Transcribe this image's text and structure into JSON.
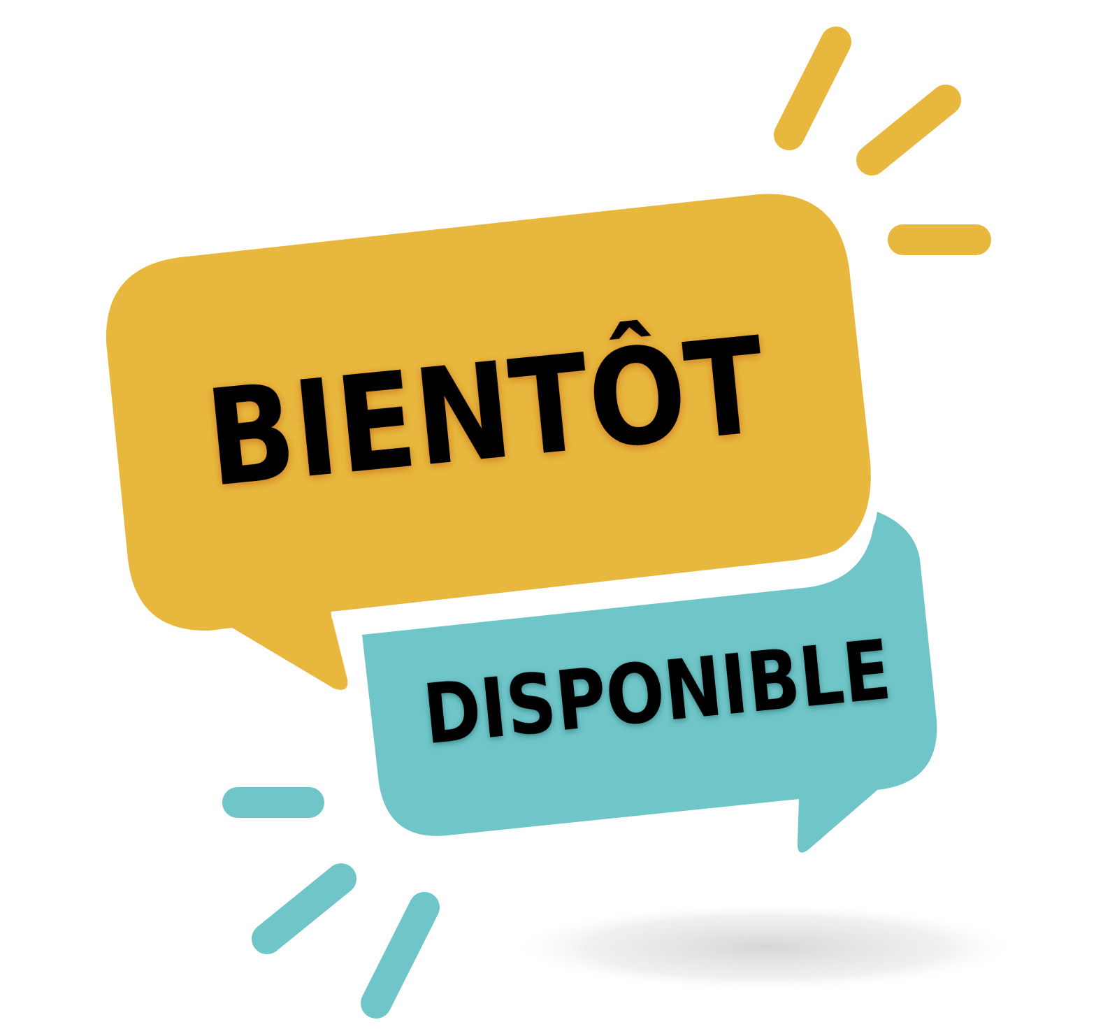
{
  "badge": {
    "primary_text": "BIENTÔT",
    "secondary_text": "DISPONIBLE"
  },
  "colors": {
    "background": "#ffffff",
    "yellow": "#E8B83E",
    "teal": "#6FC5C7",
    "text": "#000000",
    "shadow": "#d9d9d9"
  },
  "icons": {
    "burst_top_right": "yellow-burst-lines",
    "burst_bottom_left": "teal-burst-lines",
    "ground_shadow": "ellipse-shadow"
  }
}
